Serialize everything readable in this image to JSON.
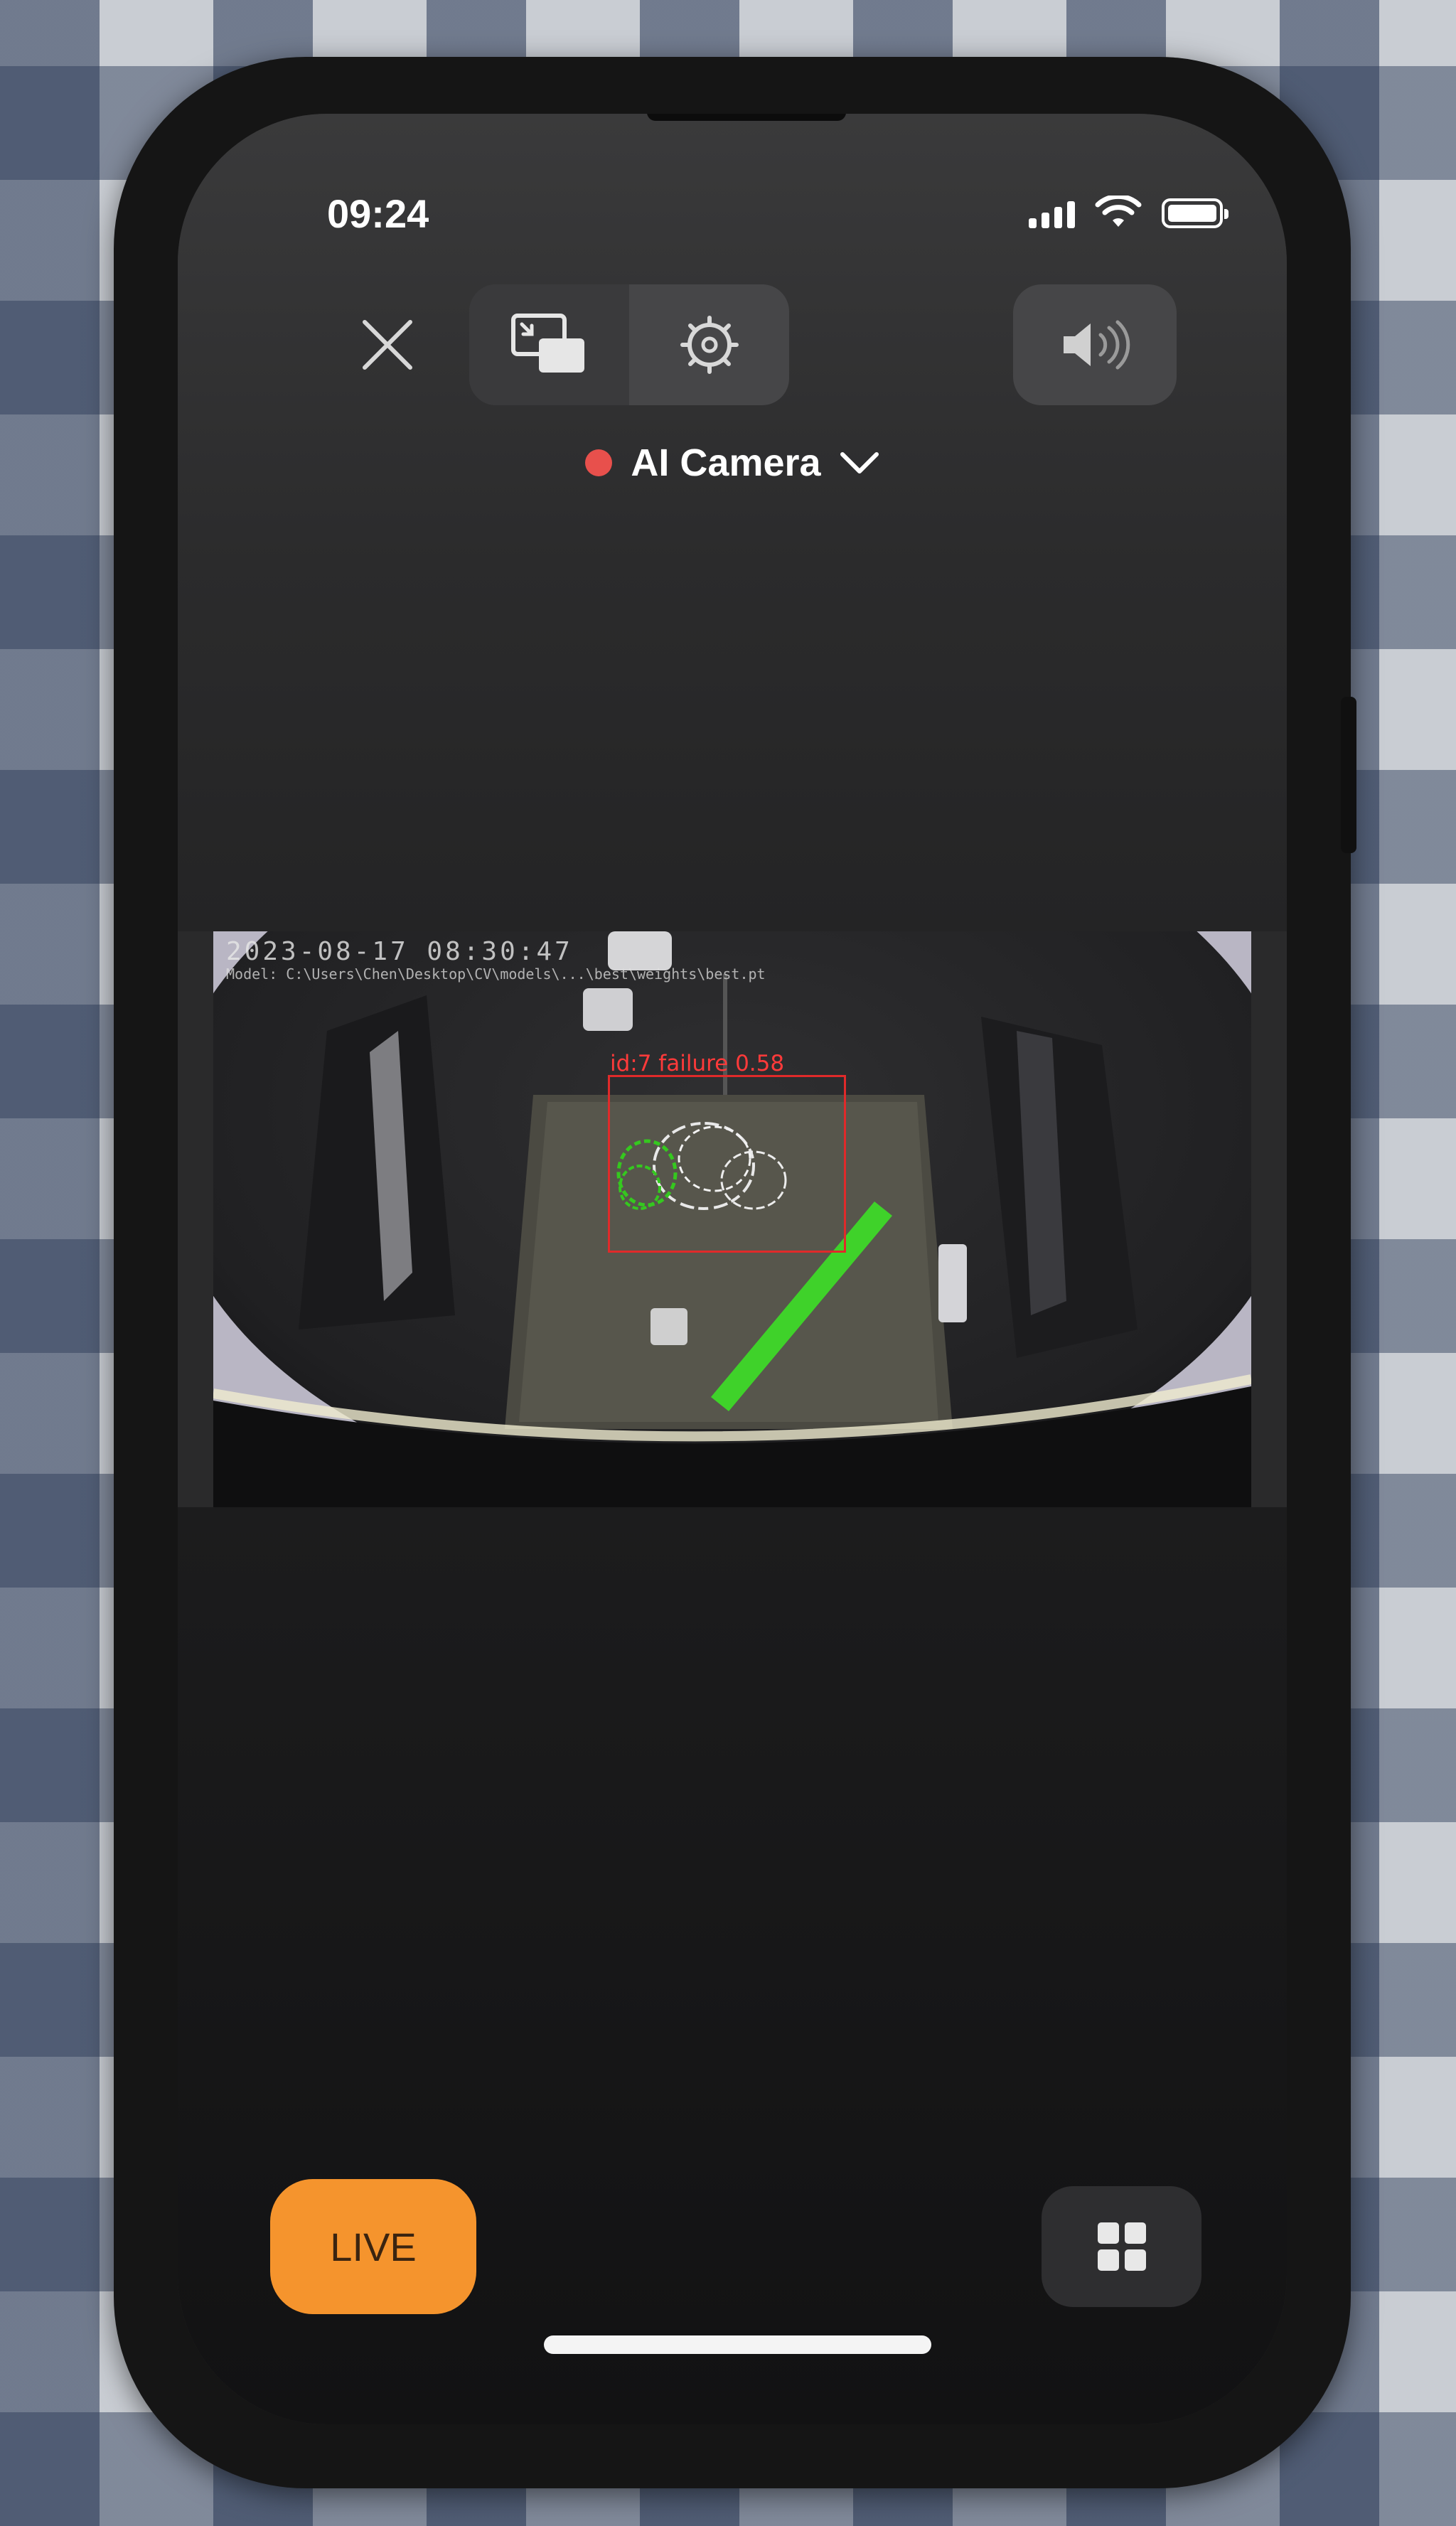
{
  "status_bar": {
    "time": "09:24",
    "signal_icon": "cellular-signal-icon",
    "wifi_icon": "wifi-icon",
    "battery_icon": "battery-full-icon"
  },
  "toolbar": {
    "close_icon": "close-icon",
    "pip_icon": "picture-in-picture-icon",
    "settings_icon": "settings-gear-icon",
    "sound_icon": "speaker-volume-icon"
  },
  "camera_selector": {
    "name": "AI Camera",
    "recording_indicator_color": "#e8504c",
    "chevron_icon": "chevron-down-icon"
  },
  "video_feed": {
    "timestamp": "2023-08-17 08:30:47",
    "model_path": "Model: C:\\Users\\Chen\\Desktop\\CV\\models\\...\\best\\weights\\best.pt",
    "detection": {
      "label": "id:7 failure 0.58",
      "box_color": "#e02a2a"
    }
  },
  "bottom_bar": {
    "live_label": "LIVE",
    "live_color": "#f5942d",
    "grid_icon": "grid-view-icon"
  }
}
